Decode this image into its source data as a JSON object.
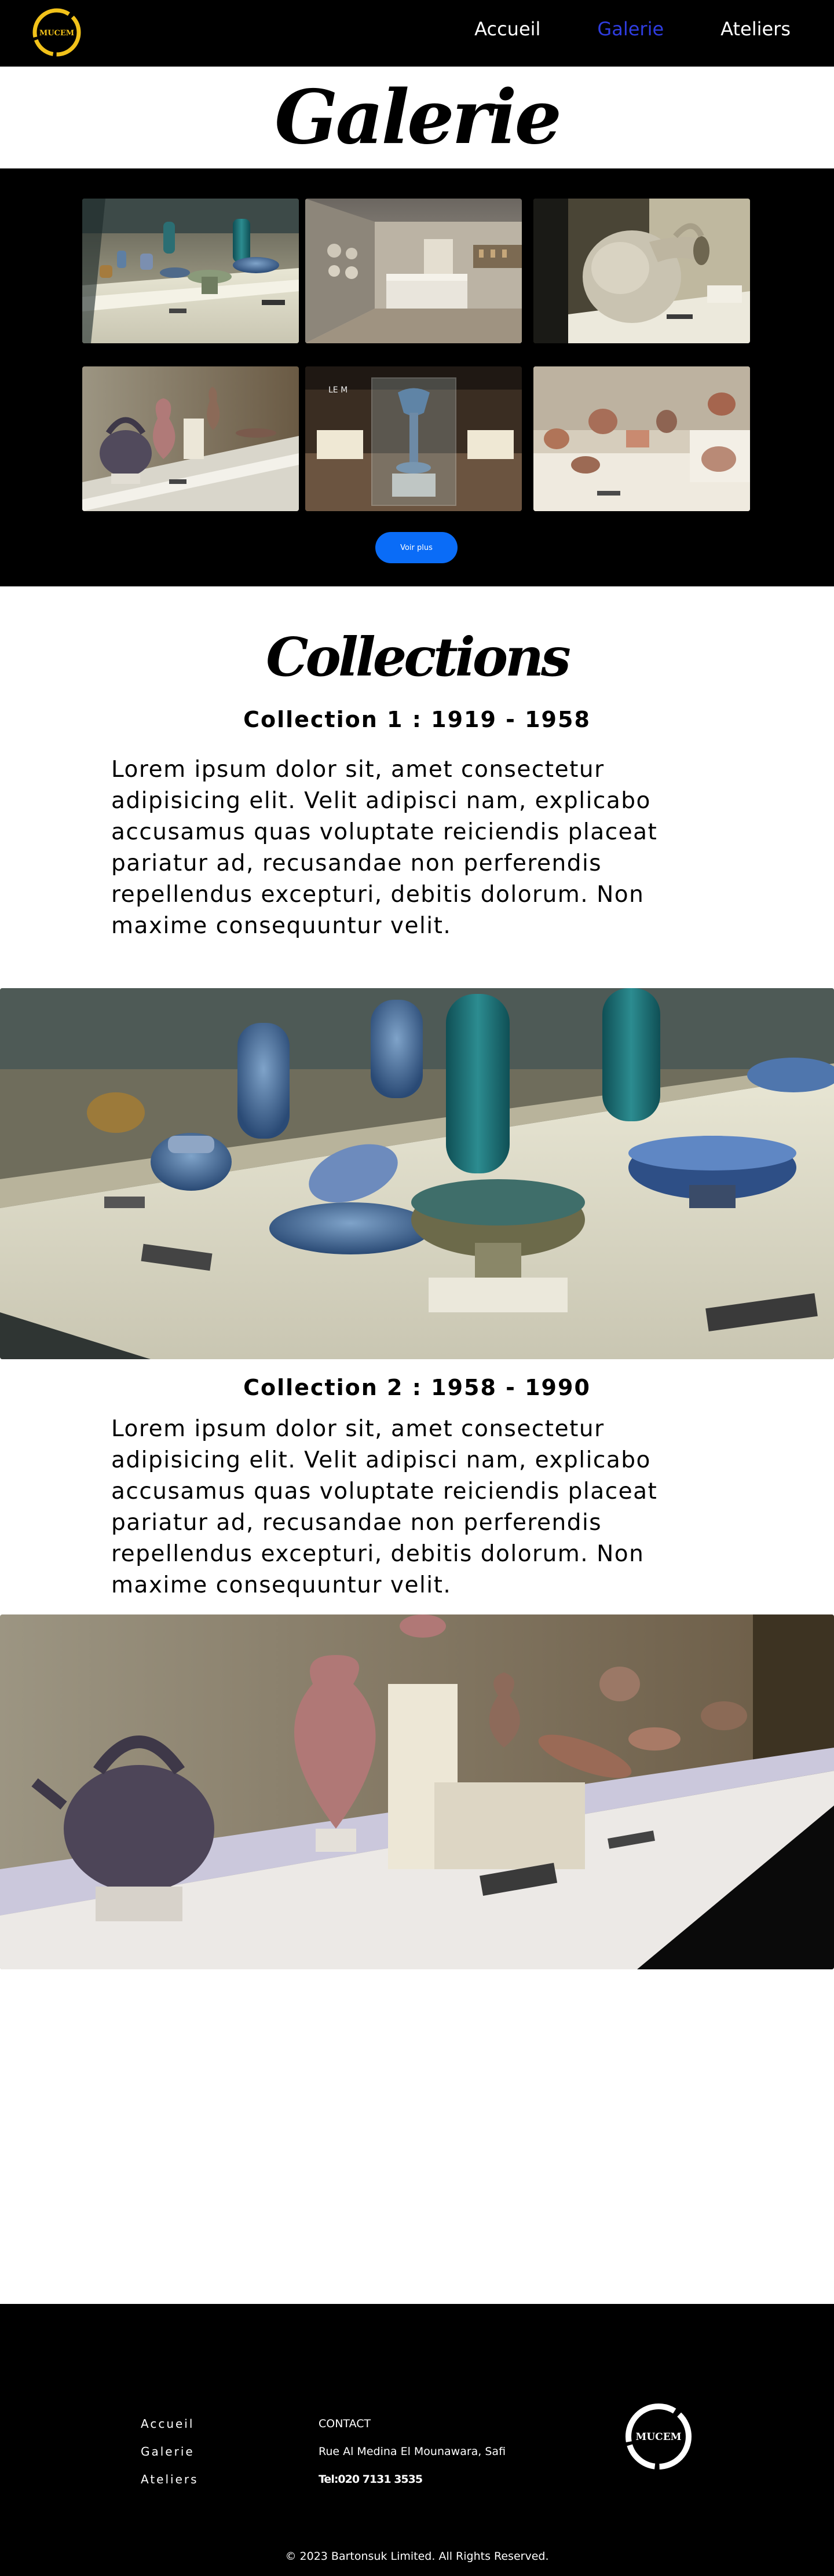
{
  "nav": {
    "logo_text": "MUCEM",
    "links": [
      {
        "label": "Accueil",
        "active": false
      },
      {
        "label": "Galerie",
        "active": true
      },
      {
        "label": "Ateliers",
        "active": false
      }
    ],
    "colors": {
      "background": "#000000",
      "active": "#2f3de0",
      "logo": "#f2c21a"
    }
  },
  "galerie": {
    "title": "Galerie",
    "photos": [
      {
        "icon": "museum-showcase-ceramics-photo"
      },
      {
        "icon": "museum-gallery-room-photo"
      },
      {
        "icon": "large-amphora-photo"
      },
      {
        "icon": "teapot-vases-photo"
      },
      {
        "icon": "glass-display-vase-photo"
      },
      {
        "icon": "pottery-shelves-photo"
      }
    ],
    "more_button": "Voir plus",
    "button_color": "#0a6cf7"
  },
  "collections": {
    "title": "Collections",
    "items": [
      {
        "heading": "Collection 1 : 1919 - 1958",
        "text": "Lorem ipsum dolor sit, amet consectetur adipisicing elit. Velit adipisci nam, explicabo accusamus quas voluptate reiciendis placeat pariatur ad, recusandae non perferendis repellendus excepturi, debitis dolorum. Non maxime consequuntur velit.",
        "photo": "blue-ceramics-showcase-photo"
      },
      {
        "heading": "Collection 2 : 1958 - 1990",
        "text": "Lorem ipsum dolor sit, amet consectetur adipisicing elit. Velit adipisci nam, explicabo accusamus quas voluptate reiciendis placeat pariatur ad, recusandae non perferendis repellendus excepturi, debitis dolorum. Non maxime consequuntur velit.",
        "photo": "teapot-pottery-showcase-photo"
      }
    ]
  },
  "footer": {
    "links": [
      "Accueil",
      "Galerie",
      "Ateliers"
    ],
    "contact_title": "CONTACT",
    "address": "Rue Al Medina El Mounawara, Safi",
    "phone": "Tel:020 7131 3535",
    "logo_text": "MUCEM",
    "copyright": "© 2023 Bartonsuk Limited. All Rights Reserved."
  }
}
